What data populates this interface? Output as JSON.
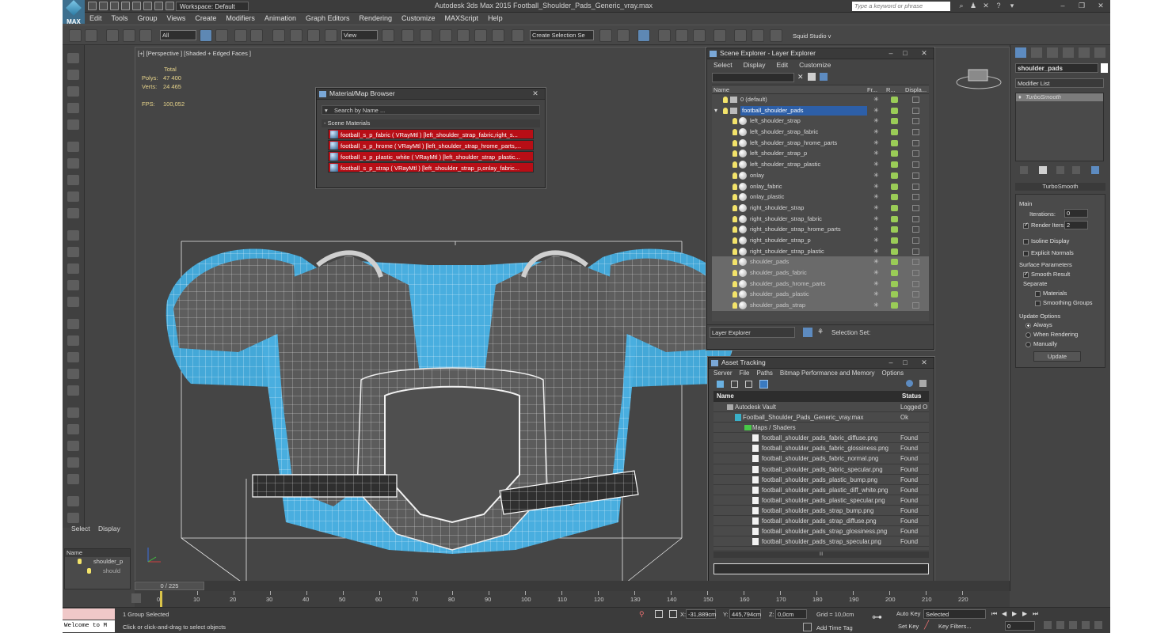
{
  "window": {
    "workspace": "Workspace: Default",
    "title": "Autodesk 3ds Max  2015     Football_Shoulder_Pads_Generic_vray.max",
    "search_placeholder": "Type a keyword or phrase",
    "logo": "MAX"
  },
  "menu": [
    "Edit",
    "Tools",
    "Group",
    "Views",
    "Create",
    "Modifiers",
    "Animation",
    "Graph Editors",
    "Rendering",
    "Customize",
    "MAXScript",
    "Help"
  ],
  "toolbar": {
    "filter": "All",
    "ref_coord": "View",
    "selection_set": "Create Selection Se",
    "renderer": "Squid Studio v"
  },
  "viewport": {
    "label": "[+] [Perspective ] [Shaded + Edged Faces ]",
    "stats_total": "Total",
    "polys_label": "Polys:",
    "polys": "47 400",
    "verts_label": "Verts:",
    "verts": "24 465",
    "fps_label": "FPS:",
    "fps": "100,052"
  },
  "material_browser": {
    "title": "Material/Map Browser",
    "search_placeholder": "Search by Name ...",
    "section": "- Scene Materials",
    "items": [
      "football_s_p_fabric ( VRayMtl ) [left_shoulder_strap_fabric,right_s...",
      "football_s_p_hrome ( VRayMtl ) [left_shoulder_strap_hrome_parts,...",
      "football_s_p_plastic_white ( VRayMtl ) [left_shoulder_strap_plastic...",
      "football_s_p_strap ( VRayMtl ) [left_shoulder_strap_p,onlay_fabric..."
    ]
  },
  "scene_explorer": {
    "title": "Scene Explorer - Layer Explorer",
    "menu": [
      "Select",
      "Display",
      "Edit",
      "Customize"
    ],
    "columns": [
      "Name",
      "Fr...",
      "R...",
      "Displa..."
    ],
    "layers": [
      {
        "name": "0 (default)",
        "indent": 1,
        "type": "layer"
      },
      {
        "name": "football_shoulder_pads",
        "indent": 1,
        "type": "layer",
        "selected": true
      },
      {
        "name": "left_shoulder_strap",
        "indent": 2,
        "type": "object"
      },
      {
        "name": "left_shoulder_strap_fabric",
        "indent": 2,
        "type": "object"
      },
      {
        "name": "left_shoulder_strap_hrome_parts",
        "indent": 2,
        "type": "object"
      },
      {
        "name": "left_shoulder_strap_p",
        "indent": 2,
        "type": "object"
      },
      {
        "name": "left_shoulder_strap_plastic",
        "indent": 2,
        "type": "object"
      },
      {
        "name": "onlay",
        "indent": 2,
        "type": "object"
      },
      {
        "name": "onlay_fabric",
        "indent": 2,
        "type": "object"
      },
      {
        "name": "onlay_plastic",
        "indent": 2,
        "type": "object"
      },
      {
        "name": "right_shoulder_strap",
        "indent": 2,
        "type": "object"
      },
      {
        "name": "right_shoulder_strap_fabric",
        "indent": 2,
        "type": "object"
      },
      {
        "name": "right_shoulder_strap_hrome_parts",
        "indent": 2,
        "type": "object"
      },
      {
        "name": "right_shoulder_strap_p",
        "indent": 2,
        "type": "object"
      },
      {
        "name": "right_shoulder_strap_plastic",
        "indent": 2,
        "type": "object"
      },
      {
        "name": "shoulder_pads",
        "indent": 2,
        "type": "object",
        "dim": true
      },
      {
        "name": "shoulder_pads_fabric",
        "indent": 2,
        "type": "object",
        "dim": true
      },
      {
        "name": "shoulder_pads_hrome_parts",
        "indent": 2,
        "type": "object",
        "dim": true
      },
      {
        "name": "shoulder_pads_plastic",
        "indent": 2,
        "type": "object",
        "dim": true
      },
      {
        "name": "shoulder_pads_strap",
        "indent": 2,
        "type": "object",
        "dim": true
      }
    ],
    "footer_mode": "Layer Explorer",
    "selection_set_label": "Selection Set:"
  },
  "asset_tracking": {
    "title": "Asset Tracking",
    "menu": [
      "Server",
      "File",
      "Paths",
      "Bitmap Performance and Memory",
      "Options"
    ],
    "columns": [
      "Name",
      "Status"
    ],
    "rows": [
      {
        "name": "Autodesk Vault",
        "status": "Logged O",
        "level": 0
      },
      {
        "name": "Football_Shoulder_Pads_Generic_vray.max",
        "status": "Ok",
        "level": 1
      },
      {
        "name": "Maps / Shaders",
        "status": "",
        "level": 2
      },
      {
        "name": "football_shoulder_pads_fabric_diffuse.png",
        "status": "Found",
        "level": 3
      },
      {
        "name": "football_shoulder_pads_fabric_glossiness.png",
        "status": "Found",
        "level": 3
      },
      {
        "name": "football_shoulder_pads_fabric_normal.png",
        "status": "Found",
        "level": 3
      },
      {
        "name": "football_shoulder_pads_fabric_specular.png",
        "status": "Found",
        "level": 3
      },
      {
        "name": "football_shoulder_pads_plastic_bump.png",
        "status": "Found",
        "level": 3
      },
      {
        "name": "football_shoulder_pads_plastic_diff_white.png",
        "status": "Found",
        "level": 3
      },
      {
        "name": "football_shoulder_pads_plastic_specular.png",
        "status": "Found",
        "level": 3
      },
      {
        "name": "football_shoulder_pads_strap_bump.png",
        "status": "Found",
        "level": 3
      },
      {
        "name": "football_shoulder_pads_strap_diffuse.png",
        "status": "Found",
        "level": 3
      },
      {
        "name": "football_shoulder_pads_strap_glossiness.png",
        "status": "Found",
        "level": 3
      },
      {
        "name": "football_shoulder_pads_strap_specular.png",
        "status": "Found",
        "level": 3
      }
    ],
    "scroll_glyph": "III"
  },
  "command_panel": {
    "object_name": "shoulder_pads",
    "modifier_list": "Modifier List",
    "stack_item": "TurboSmooth",
    "rollout_title": "TurboSmooth",
    "main_label": "Main",
    "iterations_label": "Iterations:",
    "iterations": "0",
    "render_iters_label": "Render Iters:",
    "render_iters": "2",
    "isoline": "Isoline Display",
    "explicit_normals": "Explicit Normals",
    "surface_params": "Surface Parameters",
    "smooth_result": "Smooth Result",
    "separate": "Separate",
    "materials": "Materials",
    "smoothing_groups": "Smoothing Groups",
    "update_options": "Update Options",
    "always": "Always",
    "when_rendering": "When Rendering",
    "manually": "Manually",
    "update_button": "Update"
  },
  "mini_explorer": {
    "tabs": [
      "Select",
      "Display"
    ],
    "header": "Name",
    "row1": "shoulder_p",
    "row2": "should"
  },
  "timeline": {
    "frame": "0 / 225",
    "ticks": [
      "0",
      "10",
      "20",
      "30",
      "40",
      "50",
      "60",
      "70",
      "80",
      "90",
      "100",
      "110",
      "120",
      "130",
      "140",
      "150",
      "160",
      "170",
      "180",
      "190",
      "200",
      "210",
      "220"
    ]
  },
  "status": {
    "listener": "Welcome to M",
    "selected": "1 Group Selected",
    "prompt": "Click or click-and-drag to select objects",
    "x_label": "X:",
    "x": "-31,889cm",
    "y_label": "Y:",
    "y": "445,794cm",
    "z_label": "Z:",
    "z": "0,0cm",
    "grid": "Grid = 10,0cm",
    "add_time_tag": "Add Time Tag",
    "auto_key": "Auto Key",
    "auto_key_sel": "Selected",
    "set_key": "Set Key",
    "key_filters": "Key Filters...",
    "frame": "0"
  }
}
